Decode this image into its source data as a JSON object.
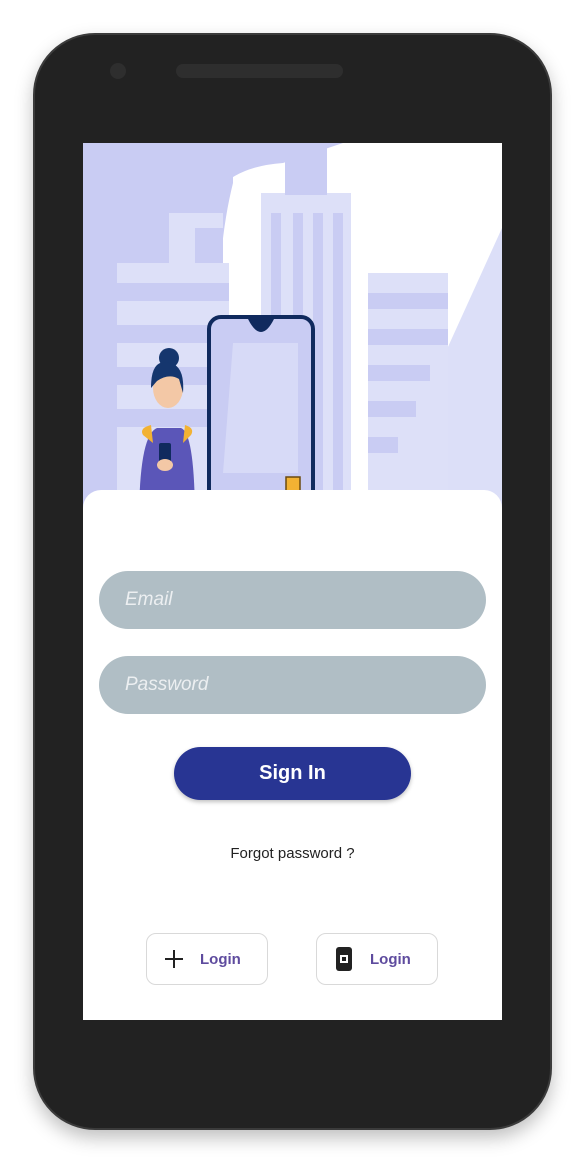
{
  "login": {
    "email_placeholder": "Email",
    "password_placeholder": "Password",
    "signin_label": "Sign In",
    "forgot_label": "Forgot password ?"
  },
  "social": [
    {
      "icon": "plus-icon",
      "label": "Login"
    },
    {
      "icon": "app-badge-icon",
      "label": "Login"
    }
  ],
  "colors": {
    "accent": "#283593",
    "field_bg": "#b0bec5",
    "illustration_light": "#dde0f8",
    "illustration_mid": "#c5c9f2",
    "link_text": "#5e4b9e"
  }
}
